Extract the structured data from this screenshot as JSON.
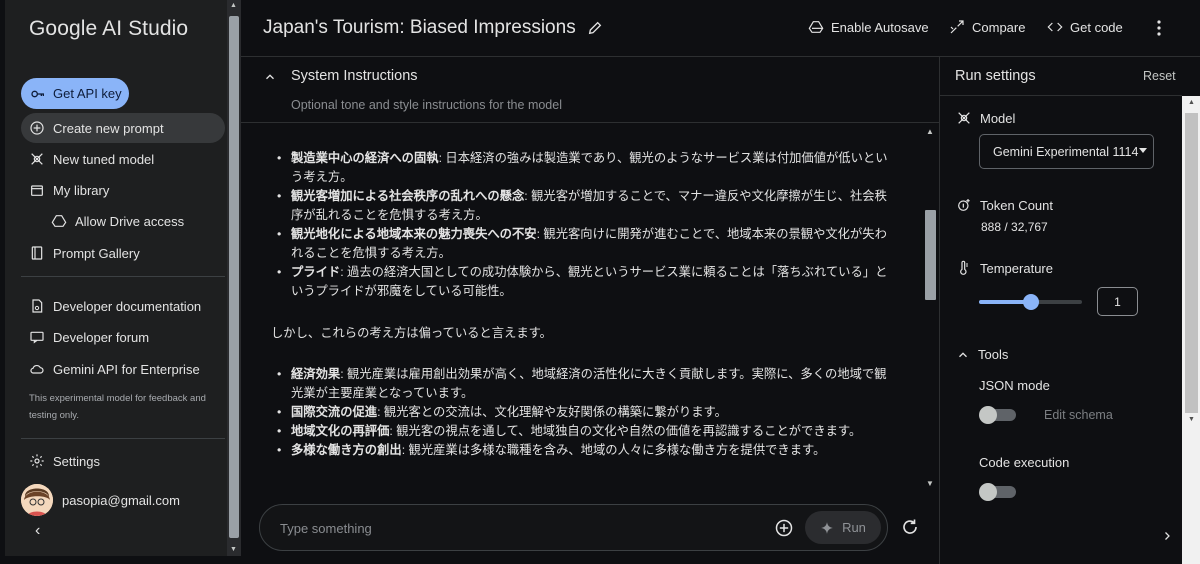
{
  "sidebar": {
    "brand": "Google AI Studio",
    "api_key_label": "Get API key",
    "nav": [
      {
        "label": "Create new prompt",
        "icon": "add-circle-icon"
      },
      {
        "label": "New tuned model",
        "icon": "tune-icon"
      },
      {
        "label": "My library",
        "icon": "library-icon"
      },
      {
        "label": "Allow Drive access",
        "icon": "drive-icon"
      },
      {
        "label": "Prompt Gallery",
        "icon": "book-icon"
      },
      {
        "label": "Developer documentation",
        "icon": "docs-icon"
      },
      {
        "label": "Developer forum",
        "icon": "forum-icon"
      },
      {
        "label": "Gemini API for Enterprise",
        "icon": "cloud-icon"
      }
    ],
    "note": "This experimental model for feedback and testing only.",
    "settings_label": "Settings",
    "user_email": "pasopia@gmail.com"
  },
  "header": {
    "title": "Japan's Tourism: Biased Impressions",
    "autosave_label": "Enable Autosave",
    "compare_label": "Compare",
    "get_code_label": "Get code"
  },
  "system_instructions": {
    "label": "System Instructions",
    "placeholder": "Optional tone and style instructions for the model"
  },
  "response": {
    "list1": [
      {
        "bold": "製造業中心の経済への固執",
        "text": ": 日本経済の強みは製造業であり、観光のようなサービス業は付加価値が低いという考え方。"
      },
      {
        "bold": "観光客増加による社会秩序の乱れへの懸念",
        "text": ": 観光客が増加することで、マナー違反や文化摩擦が生じ、社会秩序が乱れることを危惧する考え方。"
      },
      {
        "bold": "観光地化による地域本来の魅力喪失への不安",
        "text": ": 観光客向けに開発が進むことで、地域本来の景観や文化が失われることを危惧する考え方。"
      },
      {
        "bold": "プライド",
        "text": ": 過去の経済大国としての成功体験から、観光というサービス業に頼ることは「落ちぶれている」というプライドが邪魔をしている可能性。"
      }
    ],
    "paragraph": "しかし、これらの考え方は偏っていると言えます。",
    "list2": [
      {
        "bold": "経済効果",
        "text": ": 観光産業は雇用創出効果が高く、地域経済の活性化に大きく貢献します。実際に、多くの地域で観光業が主要産業となっています。"
      },
      {
        "bold": "国際交流の促進",
        "text": ": 観光客との交流は、文化理解や友好関係の構築に繋がります。"
      },
      {
        "bold": "地域文化の再評価",
        "text": ": 観光客の視点を通して、地域独自の文化や自然の価値を再認識することができます。"
      },
      {
        "bold": "多様な働き方の創出",
        "text": ": 観光産業は多様な職種を含み、地域の人々に多様な働き方を提供できます。"
      }
    ]
  },
  "prompt_input": {
    "placeholder": "Type something",
    "run_label": "Run"
  },
  "run_settings": {
    "title": "Run settings",
    "reset_label": "Reset",
    "model_label": "Model",
    "model_value": "Gemini Experimental 1114",
    "token_label": "Token Count",
    "token_value": "888 / 32,767",
    "temperature_label": "Temperature",
    "temperature_value": "1",
    "temperature_fraction": 0.5,
    "tools_label": "Tools",
    "json_mode_label": "JSON mode",
    "edit_schema_label": "Edit schema",
    "code_exec_label": "Code execution"
  },
  "colors": {
    "accent": "#8ab4f8",
    "sidebar_bg": "#1e1f20",
    "main_bg": "#0e0f12"
  }
}
